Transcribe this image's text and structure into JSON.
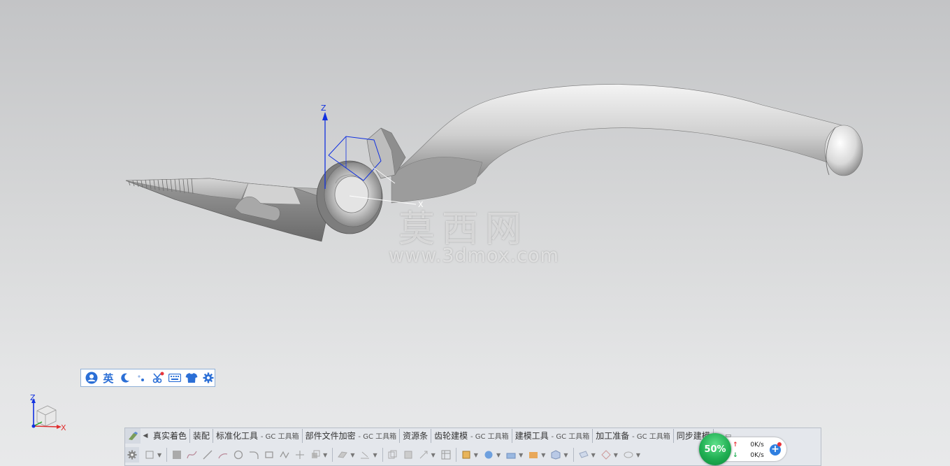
{
  "viewport": {
    "csys_labels": {
      "z": "Z",
      "x": "X"
    },
    "triad_labels": {
      "z": "Z",
      "x": "X"
    },
    "watermark": {
      "text_cn": "莫西网",
      "url": "www.3dmox.com"
    }
  },
  "ime_bar": {
    "items": [
      {
        "icon": "user-icon"
      },
      {
        "icon": "language-icon",
        "label": "英"
      },
      {
        "icon": "moon-icon"
      },
      {
        "icon": "punctuation-icon"
      },
      {
        "icon": "scissors-icon"
      },
      {
        "icon": "keyboard-icon"
      },
      {
        "icon": "shirt-icon"
      },
      {
        "icon": "gear-icon"
      }
    ]
  },
  "toolbar": {
    "tabs": [
      {
        "label": "真实着色"
      },
      {
        "label": "装配"
      },
      {
        "label": "标准化工具",
        "suffix": "- GC 工具箱"
      },
      {
        "label": "部件文件加密",
        "suffix": "- GC 工具箱"
      },
      {
        "label": "资源条"
      },
      {
        "label": "齿轮建模",
        "suffix": "- GC 工具箱"
      },
      {
        "label": "建模工具",
        "suffix": "- GC 工具箱"
      },
      {
        "label": "加工准备",
        "suffix": "- GC 工具箱"
      },
      {
        "label": "同步建模"
      }
    ]
  },
  "net_widget": {
    "percent": "50%",
    "upload": "0K/s",
    "download": "0K/s",
    "colors": {
      "ball": "#1fae52",
      "upload_arrow": "#e8343a",
      "download_arrow": "#1fae52",
      "plus": "#2f7fe0"
    }
  },
  "colors": {
    "accent": "#2b6fd6",
    "axis_z": "#1030e0",
    "axis_x": "#e03030"
  }
}
